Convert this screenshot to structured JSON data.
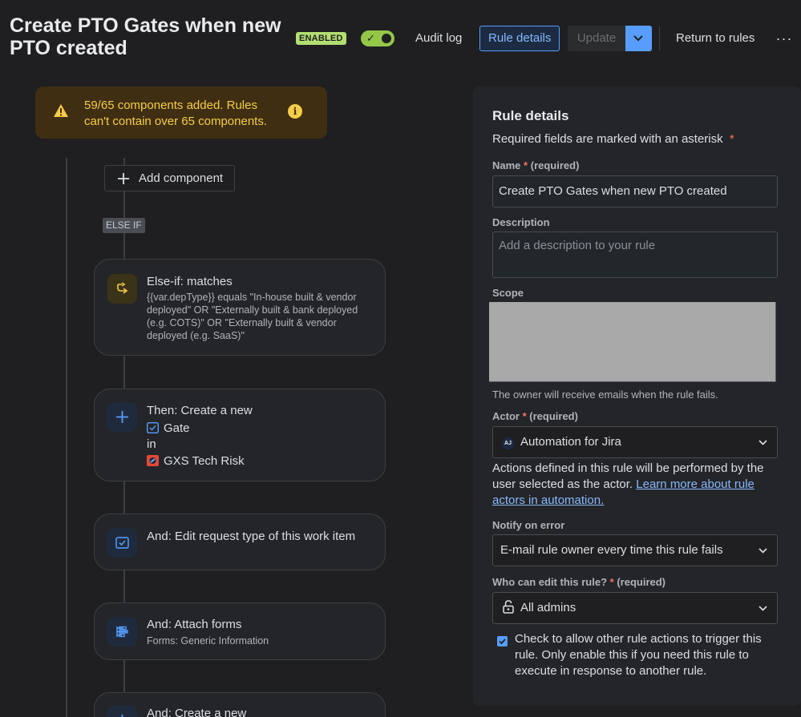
{
  "header": {
    "title": "Create PTO Gates when new PTO created",
    "status_badge": "ENABLED",
    "audit_log": "Audit log",
    "rule_details": "Rule details",
    "update": "Update",
    "return_to_rules": "Return to rules",
    "more": "···"
  },
  "warning": {
    "text": "59/65 components added. Rules can't contain over 65 components.",
    "info_icon": "i"
  },
  "canvas": {
    "add_component": "Add component",
    "else_if_tag": "ELSE IF",
    "cards": [
      {
        "title": "Else-if: matches",
        "subtitle": "{{var.depType}} equals \"In-house built & vendor deployed\" OR \"Externally built & bank deployed (e.g. COTS)\" OR \"Externally built & vendor deployed (e.g. SaaS)\"",
        "icon": "branch-icon"
      },
      {
        "title": "Then: Create a new",
        "line1": "Gate",
        "line2": "in",
        "line3": "GXS Tech Risk",
        "icon": "plus-icon"
      },
      {
        "title": "And: Edit request type of this work item",
        "icon": "request-type-icon"
      },
      {
        "title": "And: Attach forms",
        "subtitle": "Forms: Generic Information",
        "icon": "form-icon"
      },
      {
        "title": "And: Create a new",
        "icon": "plus-icon"
      }
    ]
  },
  "panel": {
    "heading": "Rule details",
    "required_note": "Required fields are marked with an asterisk",
    "asterisk": "*",
    "name_label": "Name",
    "required_suffix": "(required)",
    "name_value": "Create PTO Gates when new PTO created",
    "description_label": "Description",
    "description_placeholder": "Add a description to your rule",
    "scope_label": "Scope",
    "owner_help": "The owner will receive emails when the rule fails.",
    "actor_label": "Actor",
    "actor_value": "Automation for Jira",
    "actor_avatar": "AJ",
    "actor_help_prefix": "Actions defined in this rule will be performed by the user selected as the actor. ",
    "actor_help_link": "Learn more about rule actors in automation.",
    "notify_label": "Notify on error",
    "notify_value": "E-mail rule owner every time this rule fails",
    "who_edit_label": "Who can edit this rule?",
    "who_edit_value": "All admins",
    "checkbox_label": "Check to allow other rule actions to trigger this rule. Only enable this if you need this rule to execute in response to another rule.",
    "checkbox_checked": true
  },
  "colors": {
    "accent": "#579dff",
    "enabled_badge": "#b3df72",
    "toggle_on": "#94c748",
    "warning_bg": "#3f2e12",
    "warning_text": "#f5cd47"
  }
}
